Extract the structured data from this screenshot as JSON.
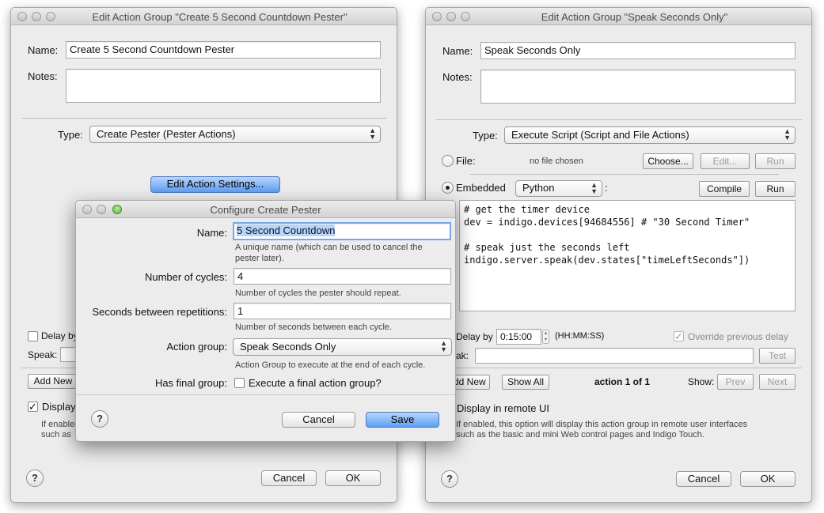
{
  "left_window": {
    "title": "Edit Action Group \"Create 5 Second Countdown Pester\"",
    "name_label": "Name:",
    "name_value": "Create 5 Second Countdown Pester",
    "notes_label": "Notes:",
    "type_label": "Type:",
    "type_value": "Create Pester (Pester Actions)",
    "edit_settings_button": "Edit Action Settings...",
    "delay_label": "Delay by",
    "speak_label": "Speak:",
    "add_new_button": "Add New",
    "display_label": "Display",
    "desc_line1": "If enabled",
    "desc_line2": "such as",
    "cancel_button": "Cancel",
    "ok_button": "OK",
    "help": "?"
  },
  "right_window": {
    "title": "Edit Action Group \"Speak Seconds Only\"",
    "name_label": "Name:",
    "name_value": "Speak Seconds Only",
    "notes_label": "Notes:",
    "type_label": "Type:",
    "type_value": "Execute Script (Script and File Actions)",
    "file_label": "File:",
    "no_file": "no file chosen",
    "choose_button": "Choose...",
    "edit_button": "Edit...",
    "run_button": "Run",
    "embedded_label": "Embedded",
    "language": "Python",
    "colon": ":",
    "compile_button": "Compile",
    "run_button2": "Run",
    "code": "# get the timer device\ndev = indigo.devices[94684556] # \"30 Second Timer\"\n\n# speak just the seconds left\nindigo.server.speak(dev.states[\"timeLeftSeconds\"])",
    "delay_label": "Delay by",
    "delay_value": "0:15:00",
    "delay_format": "(HH:MM:SS)",
    "override_label": "Override previous delay",
    "speak_label": "ak:",
    "test_button": "Test",
    "add_new_button": "dd New",
    "show_all_button": "Show All",
    "action_count": "action 1 of 1",
    "show_label": "Show:",
    "prev_button": "Prev",
    "next_button": "Next",
    "display_label": "Display in remote UI",
    "desc_line1": "If enabled, this option will display this action group in remote user interfaces",
    "desc_line2": "such as the basic and mini Web control pages and Indigo Touch.",
    "cancel_button": "Cancel",
    "ok_button": "OK",
    "help": "?"
  },
  "dialog": {
    "title": "Configure Create Pester",
    "name_label": "Name:",
    "name_value": "5 Second Countdown",
    "name_hint1": "A unique name (which can be used to cancel the",
    "name_hint2": "pester later).",
    "cycles_label": "Number of cycles:",
    "cycles_value": "4",
    "cycles_hint": "Number of cycles the pester should repeat.",
    "seconds_label": "Seconds between repetitions:",
    "seconds_value": "1",
    "seconds_hint": "Number of seconds between each cycle.",
    "action_group_label": "Action group:",
    "action_group_value": "Speak Seconds Only",
    "action_group_hint": "Action Group to execute at the end of each cycle.",
    "final_label": "Has final group:",
    "final_checkbox_label": "Execute a final action group?",
    "cancel_button": "Cancel",
    "save_button": "Save",
    "help": "?"
  },
  "colors": {
    "accent_blue": "#5e9ff2",
    "window_bg": "#ececec"
  }
}
